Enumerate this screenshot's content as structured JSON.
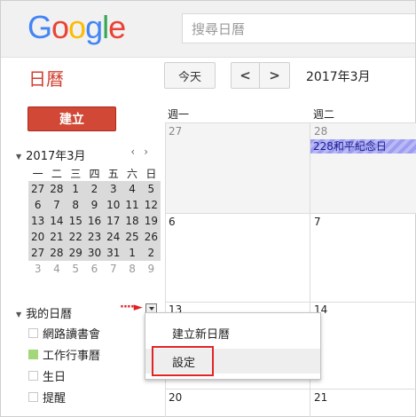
{
  "header": {
    "logo": [
      "G",
      "o",
      "o",
      "g",
      "l",
      "e"
    ],
    "logo_colors": [
      "#4285f4",
      "#ea4335",
      "#fbbc05",
      "#4285f4",
      "#34a853",
      "#ea4335"
    ],
    "search_placeholder": "搜尋日曆"
  },
  "toolbar": {
    "app_title": "日曆",
    "today": "今天",
    "prev": "<",
    "next": ">",
    "current_month": "2017年3月"
  },
  "sidebar": {
    "create_label": "建立",
    "mini_calendar": {
      "title": "2017年3月",
      "prev": "‹",
      "next": "›",
      "weekdays": [
        "一",
        "二",
        "三",
        "四",
        "五",
        "六",
        "日"
      ],
      "weeks": [
        [
          "27",
          "28",
          "1",
          "2",
          "3",
          "4",
          "5"
        ],
        [
          "6",
          "7",
          "8",
          "9",
          "10",
          "11",
          "12"
        ],
        [
          "13",
          "14",
          "15",
          "16",
          "17",
          "18",
          "19"
        ],
        [
          "20",
          "21",
          "22",
          "23",
          "24",
          "25",
          "26"
        ],
        [
          "27",
          "28",
          "29",
          "30",
          "31",
          "1",
          "2"
        ],
        [
          "3",
          "4",
          "5",
          "6",
          "7",
          "8",
          "9"
        ]
      ]
    },
    "my_calendars": {
      "title": "我的日曆",
      "items": [
        {
          "label": "網路讀書會",
          "color": "#ffffff"
        },
        {
          "label": "工作行事曆",
          "color": "#a4d67a"
        },
        {
          "label": "生日",
          "color": "#ffffff"
        },
        {
          "label": "提醒",
          "color": "#ffffff"
        }
      ]
    }
  },
  "grid": {
    "weekdays": [
      "週一",
      "週二"
    ],
    "rows": [
      [
        "27",
        "28"
      ],
      [
        "6",
        "7"
      ],
      [
        "13",
        "14"
      ],
      [
        "20",
        "21"
      ]
    ],
    "event": "228和平紀念日"
  },
  "menu": {
    "items": [
      "建立新日曆",
      "設定"
    ]
  },
  "accent_colors": {
    "red": "#d14836",
    "annotation_red": "#e02525",
    "event_blue": "#9c9cf0"
  }
}
